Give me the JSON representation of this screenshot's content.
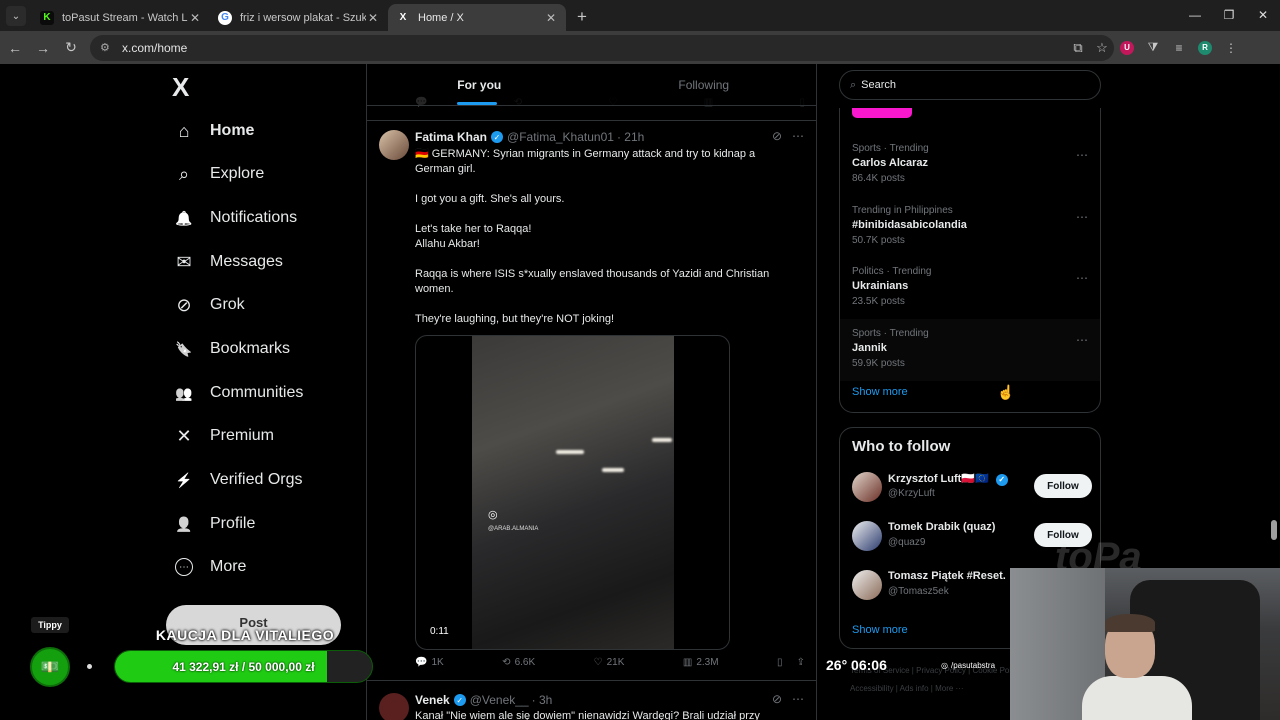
{
  "browser": {
    "tabs": [
      {
        "title": "toPasut Stream - Watch Live on",
        "favicon": "K",
        "favicon_color": "#53fc18"
      },
      {
        "title": "friz i wersow plakat - Szukaj w G",
        "favicon": "G",
        "favicon_color": "#4285f4"
      },
      {
        "title": "Home / X",
        "favicon": "X",
        "favicon_color": "#ffffff"
      }
    ],
    "url": "x.com/home"
  },
  "nav": {
    "logo": "X",
    "items": [
      {
        "label": "Home",
        "icon": "home-icon",
        "glyph": "⌂"
      },
      {
        "label": "Explore",
        "icon": "search-icon",
        "glyph": "⌕"
      },
      {
        "label": "Notifications",
        "icon": "bell-icon",
        "glyph": "🔔"
      },
      {
        "label": "Messages",
        "icon": "envelope-icon",
        "glyph": "✉"
      },
      {
        "label": "Grok",
        "icon": "grok-icon",
        "glyph": "⊘"
      },
      {
        "label": "Bookmarks",
        "icon": "bookmark-icon",
        "glyph": "🔖"
      },
      {
        "label": "Communities",
        "icon": "people-icon",
        "glyph": "👥"
      },
      {
        "label": "Premium",
        "icon": "x-icon",
        "glyph": "✕"
      },
      {
        "label": "Verified Orgs",
        "icon": "lightning-icon",
        "glyph": "⚡"
      },
      {
        "label": "Profile",
        "icon": "person-icon",
        "glyph": "👤"
      },
      {
        "label": "More",
        "icon": "more-circle-icon",
        "glyph": "⋯"
      }
    ],
    "post_label": "Post"
  },
  "timeline": {
    "tabs": [
      "For you",
      "Following"
    ],
    "tweet": {
      "name": "Fatima Khan",
      "handle": "@Fatima_Khatun01",
      "time": "· 21h",
      "paragraphs": [
        "🇩🇪 GERMANY: Syrian migrants in Germany attack and try to kidnap a German girl.",
        "I got you a gift. She's all yours.",
        "Let's take her to Raqqa!\nAllahu Akbar!",
        "Raqqa is where ISIS s*xually enslaved thousands of Yazidi and Christian women.",
        "They're laughing, but they're NOT joking!"
      ],
      "video_duration": "0:11",
      "video_watermark": "@ARAB.ALMANIA",
      "actions": {
        "replies": "1K",
        "reposts": "6.6K",
        "likes": "21K",
        "views": "2.3M"
      }
    },
    "next_tweet": {
      "name": "Venek",
      "handle": "@Venek__",
      "time": "· 3h",
      "text": "Kanał \"Nie wiem ale się dowiem\" nienawidzi Wardęgi? Brali udział przy"
    }
  },
  "sidebar": {
    "search_placeholder": "Search",
    "trends": [
      {
        "category": "Sports · Trending",
        "topic": "Carlos Alcaraz",
        "count": "86.4K posts"
      },
      {
        "category": "Trending in Philippines",
        "topic": "#binibidasabicolandia",
        "count": "50.7K posts"
      },
      {
        "category": "Politics · Trending",
        "topic": "Ukrainians",
        "count": "23.5K posts"
      },
      {
        "category": "Sports · Trending",
        "topic": "Jannik",
        "count": "59.9K posts"
      }
    ],
    "show_more": "Show more",
    "who_to_follow": {
      "title": "Who to follow",
      "accounts": [
        {
          "name": "Krzysztof Luft🇵🇱🇪🇺",
          "handle": "@KrzyLuft",
          "verified": true,
          "follow": "Follow"
        },
        {
          "name": "Tomek Drabik (quaz)",
          "handle": "@quaz9",
          "verified": false,
          "follow": "Follow"
        },
        {
          "name": "Tomasz Piątek #Reset.",
          "handle": "@Tomasz5ek",
          "verified": false,
          "follow": ""
        }
      ],
      "show_more": "Show more"
    },
    "footer": [
      "Terms of Service",
      "Privacy Policy",
      "Cookie Policy",
      "Accessibility",
      "Ads info",
      "More ···"
    ]
  },
  "overlay": {
    "tippy": "Tippy",
    "goal_title": "KAUCJA DLA VITALIEGO",
    "goal_text": "41 322,91 zł / 50 000,00 zł",
    "goal_progress": 0.826,
    "clock": "26° 06:06",
    "channel": "/pasutabstra"
  }
}
